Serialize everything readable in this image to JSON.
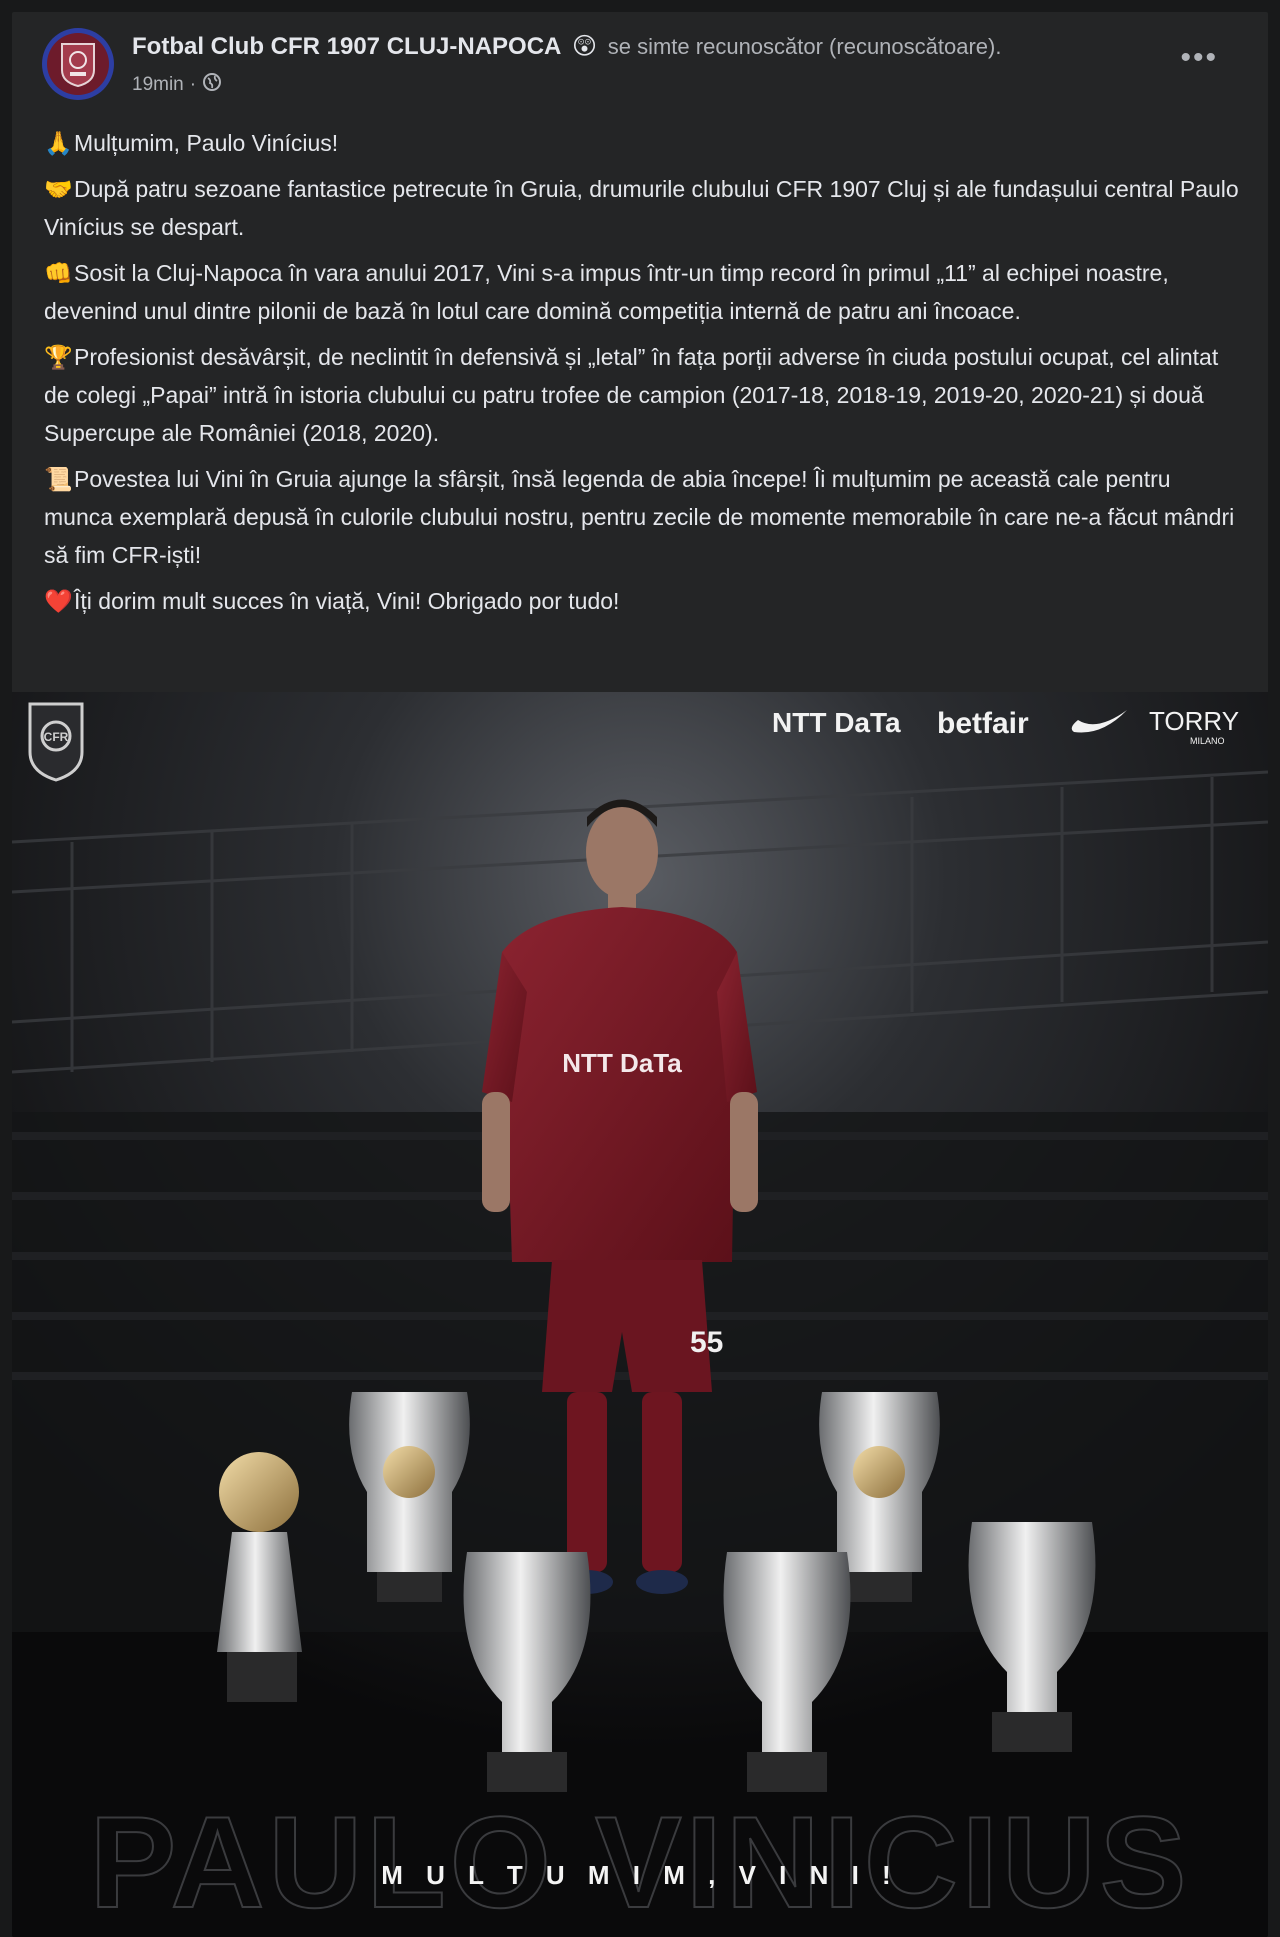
{
  "post": {
    "author": "Fotbal Club CFR 1907 CLUJ-NAPOCA",
    "feeling_emoji": "😲",
    "feeling_text": "se simte recunoscător (recunoscătoare).",
    "time": "19min",
    "audience_icon": "globe-icon",
    "more_icon": "more-options-icon",
    "paragraphs": [
      {
        "emoji": "🙏",
        "text": "Mulțumim, Paulo Vinícius!"
      },
      {
        "emoji": "🤝",
        "text": "După patru sezoane fantastice petrecute în Gruia, drumurile clubului CFR 1907 Cluj și ale fundașului central Paulo Vinícius se despart."
      },
      {
        "emoji": "👊",
        "text": "Sosit la Cluj-Napoca în vara anului 2017, Vini s-a impus într-un timp record în primul „11” al echipei noastre, devenind unul dintre pilonii de bază în lotul care domină competiția internă de patru ani încoace."
      },
      {
        "emoji": "🏆",
        "text": "Profesionist desăvârșit, de neclintit în defensivă și „letal” în fața porții adverse în ciuda postului ocupat, cel alintat de colegi „Papai” intră în istoria clubului cu patru trofee de campion (2017-18, 2018-19, 2019-20, 2020-21) și două Supercupe ale României (2018, 2020)."
      },
      {
        "emoji": "📜",
        "text": "Povestea lui Vini în Gruia ajunge la sfârșit, însă legenda de abia începe! Îi mulțumim pe această cale pentru munca exemplară depusă în culorile clubului nostru, pentru zecile de momente memorabile în care ne-a făcut mândri să fim CFR-iști!"
      },
      {
        "emoji": "❤️",
        "text": "Îți dorim mult succes în viață, Vini! Obrigado por tudo!"
      }
    ]
  },
  "image": {
    "sponsors": [
      "NTT DaTa",
      "betfair",
      "TORRY",
      "MILANO"
    ],
    "shirt_sponsor": "NTT DaTa",
    "shirt_number": "55",
    "club_crest": "CFR",
    "background_name": "PAULO VINICIUS",
    "caption": "M U L T U M I M ,   V I N I !",
    "colors": {
      "shirt": "#7a1a24",
      "accent": "#c9c9c9"
    }
  }
}
